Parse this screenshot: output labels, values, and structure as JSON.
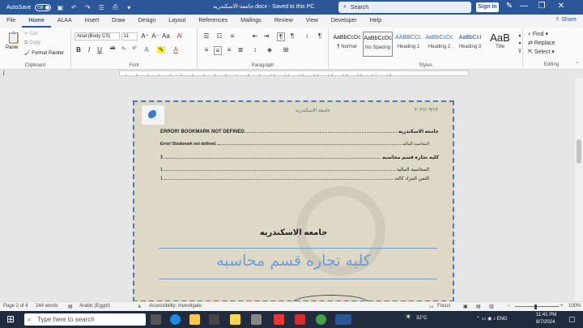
{
  "titlebar": {
    "autosave_label": "AutoSave",
    "autosave_state": "Off",
    "document_title": "جامعة-الاسكندريه.docx  -  Saved to this PC",
    "search_placeholder": "Search",
    "signin_label": "Sign in",
    "minimize": "—",
    "restore": "❐",
    "close": "✕"
  },
  "tabs": [
    "File",
    "Home",
    "ALAA",
    "Insert",
    "Draw",
    "Design",
    "Layout",
    "References",
    "Mailings",
    "Review",
    "View",
    "Developer",
    "Help"
  ],
  "share_label": "Share",
  "ribbon": {
    "clipboard": {
      "paste": "Paste",
      "cut": "Cut",
      "copy": "Copy",
      "format_painter": "Format Painter",
      "label": "Clipboard"
    },
    "font": {
      "name": "Arial (Body CS)",
      "size": "11",
      "label": "Font",
      "bold": "B",
      "italic": "I",
      "underline": "U",
      "strike": "ab",
      "sub": "x₂",
      "sup": "x²"
    },
    "paragraph": {
      "label": "Paragraph"
    },
    "styles": {
      "label": "Styles",
      "items": [
        {
          "preview": "AaBbCcDc",
          "name": "¶ Normal"
        },
        {
          "preview": "AaBbCcDc",
          "name": "No Spacing"
        },
        {
          "preview": "AABBCCL",
          "name": "Heading 1"
        },
        {
          "preview": "AaBbCcDc",
          "name": "Heading 2"
        },
        {
          "preview": "AaBbCcI",
          "name": "Heading 3"
        },
        {
          "preview": "AaB",
          "name": "Title"
        }
      ]
    },
    "editing": {
      "find": "Find",
      "replace": "Replace",
      "select": "Select",
      "label": "Editing"
    }
  },
  "ruler": "1 · 2 · 1 · 2 · 1 · 2 · 3 · 4 · 5 · 6 · 7 · 8 · 9 · 10 · 11 · 12 · 13 · 14 · 15 · 16 · 17 · 18",
  "document": {
    "header_date": "٢٠٢١/٠٩/١٣",
    "header_center": "جامعة الاسكندريه",
    "toc": [
      {
        "title": "جامعه الاسكندريه",
        "page": "ERROR! BOOKMARK NOT DEFINED.",
        "bold": true
      },
      {
        "title": "المحاسبه الماليه",
        "page": "Error! Bookmark not defined.",
        "bold": false
      },
      {
        "title": "كليه تجاره قسم محاسبه",
        "page": "1",
        "bold": true
      },
      {
        "title": "المحاسبة المالية",
        "page": "1",
        "bold": false
      },
      {
        "title": "الثمن المزاد كالنه",
        "page": "1",
        "bold": false
      }
    ],
    "university_title": "جامعه الاسكندريه",
    "faculty_title": "كليه تجاره قسم محاسبه"
  },
  "statusbar": {
    "page": "Page 2 of 4",
    "words": "244 words",
    "language": "Arabic (Egypt)",
    "accessibility": "Accessibility: Investigate",
    "focus": "Focus",
    "zoom": "100%"
  },
  "taskbar": {
    "search_placeholder": "Type here to search",
    "weather": "32°C",
    "time": "11:41 PM",
    "date": "8/7/2024"
  }
}
